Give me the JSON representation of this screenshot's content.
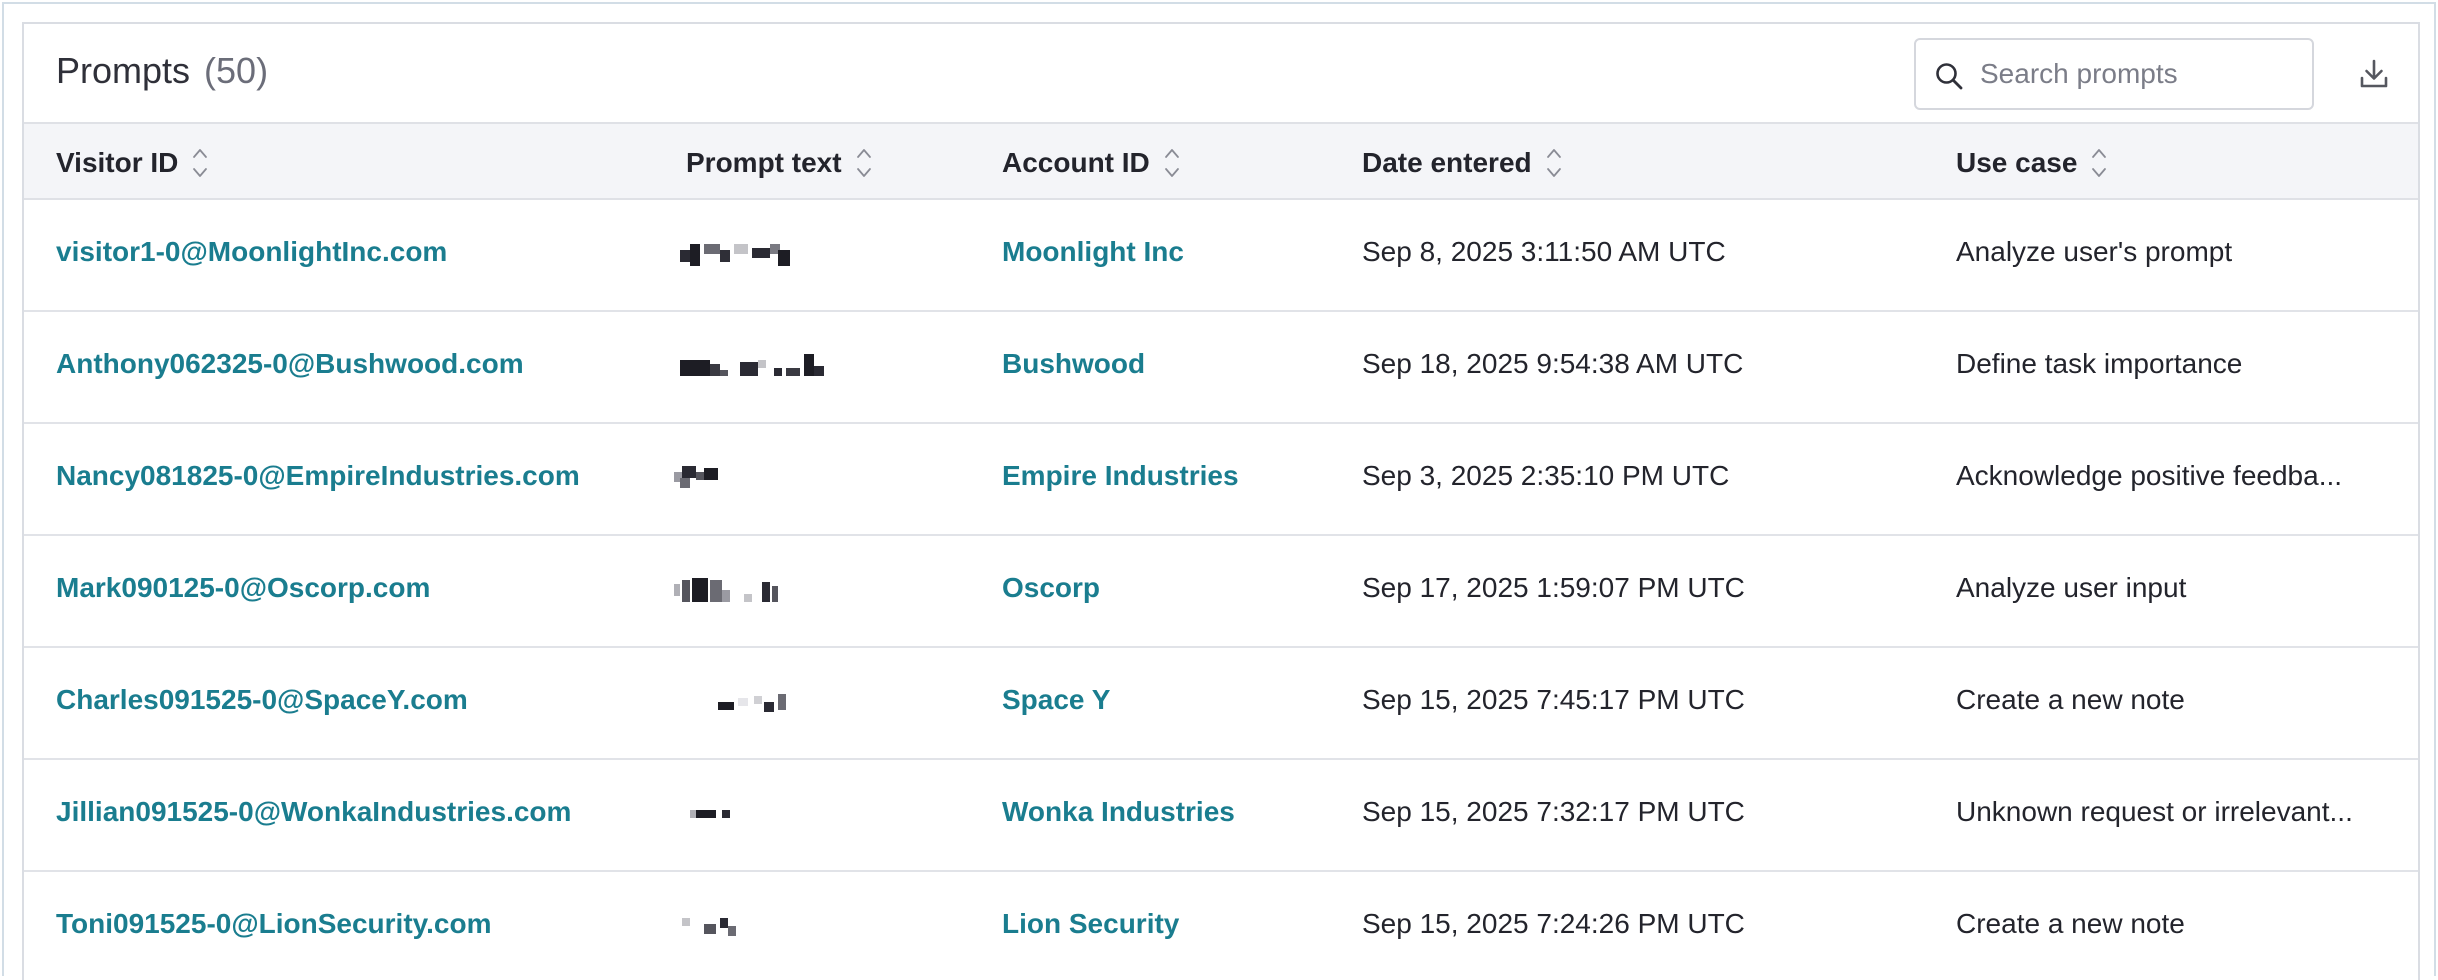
{
  "header": {
    "title": "Prompts",
    "count": "(50)",
    "search_placeholder": "Search prompts"
  },
  "icons": {
    "search": "search-icon",
    "download": "download-icon",
    "sort": "sort-icon"
  },
  "colors": {
    "link": "#1a7d8f",
    "header_bg": "#f4f5f8",
    "border": "#dfe1e6"
  },
  "columns": [
    "Visitor ID",
    "Prompt text",
    "Account ID",
    "Date entered",
    "Use case"
  ],
  "rows": [
    {
      "visitor": "visitor1-0@MoonlightInc.com",
      "account": "Moonlight Inc",
      "date": "Sep 8, 2025 3:11:50 AM UTC",
      "use_case": "Analyze user's prompt"
    },
    {
      "visitor": "Anthony062325-0@Bushwood.com",
      "account": "Bushwood",
      "date": "Sep 18, 2025 9:54:38 AM UTC",
      "use_case": "Define task importance"
    },
    {
      "visitor": "Nancy081825-0@EmpireIndustries.com",
      "account": "Empire Industries",
      "date": "Sep 3, 2025 2:35:10 PM UTC",
      "use_case": "Acknowledge positive feedba..."
    },
    {
      "visitor": "Mark090125-0@Oscorp.com",
      "account": "Oscorp",
      "date": "Sep 17, 2025 1:59:07 PM UTC",
      "use_case": "Analyze user input"
    },
    {
      "visitor": "Charles091525-0@SpaceY.com",
      "account": "Space Y",
      "date": "Sep 15, 2025 7:45:17 PM UTC",
      "use_case": "Create a new note"
    },
    {
      "visitor": "Jillian091525-0@WonkaIndustries.com",
      "account": "Wonka Industries",
      "date": "Sep 15, 2025 7:32:17 PM UTC",
      "use_case": "Unknown request or irrelevant..."
    },
    {
      "visitor": "Toni091525-0@LionSecurity.com",
      "account": "Lion Security",
      "date": "Sep 15, 2025 7:24:26 PM UTC",
      "use_case": "Create a new note"
    }
  ]
}
